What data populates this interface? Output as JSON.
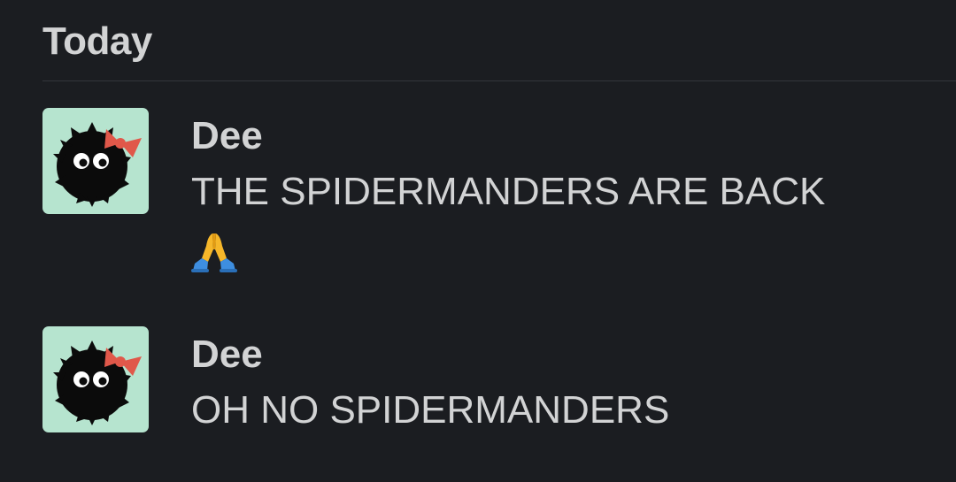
{
  "day_header": "Today",
  "messages": [
    {
      "author": "Dee",
      "text": "THE SPIDERMANDERS ARE BACK",
      "reaction_emoji": "folded-hands"
    },
    {
      "author": "Dee",
      "text": "OH NO SPIDERMANDERS"
    }
  ],
  "colors": {
    "background": "#1b1d21",
    "text": "#d2d3d4",
    "avatar_bg": "#b6e4cf",
    "bow": "#e0584a",
    "emoji_sleeve": "#3e8ee0",
    "emoji_hands": "#f6b72a"
  }
}
